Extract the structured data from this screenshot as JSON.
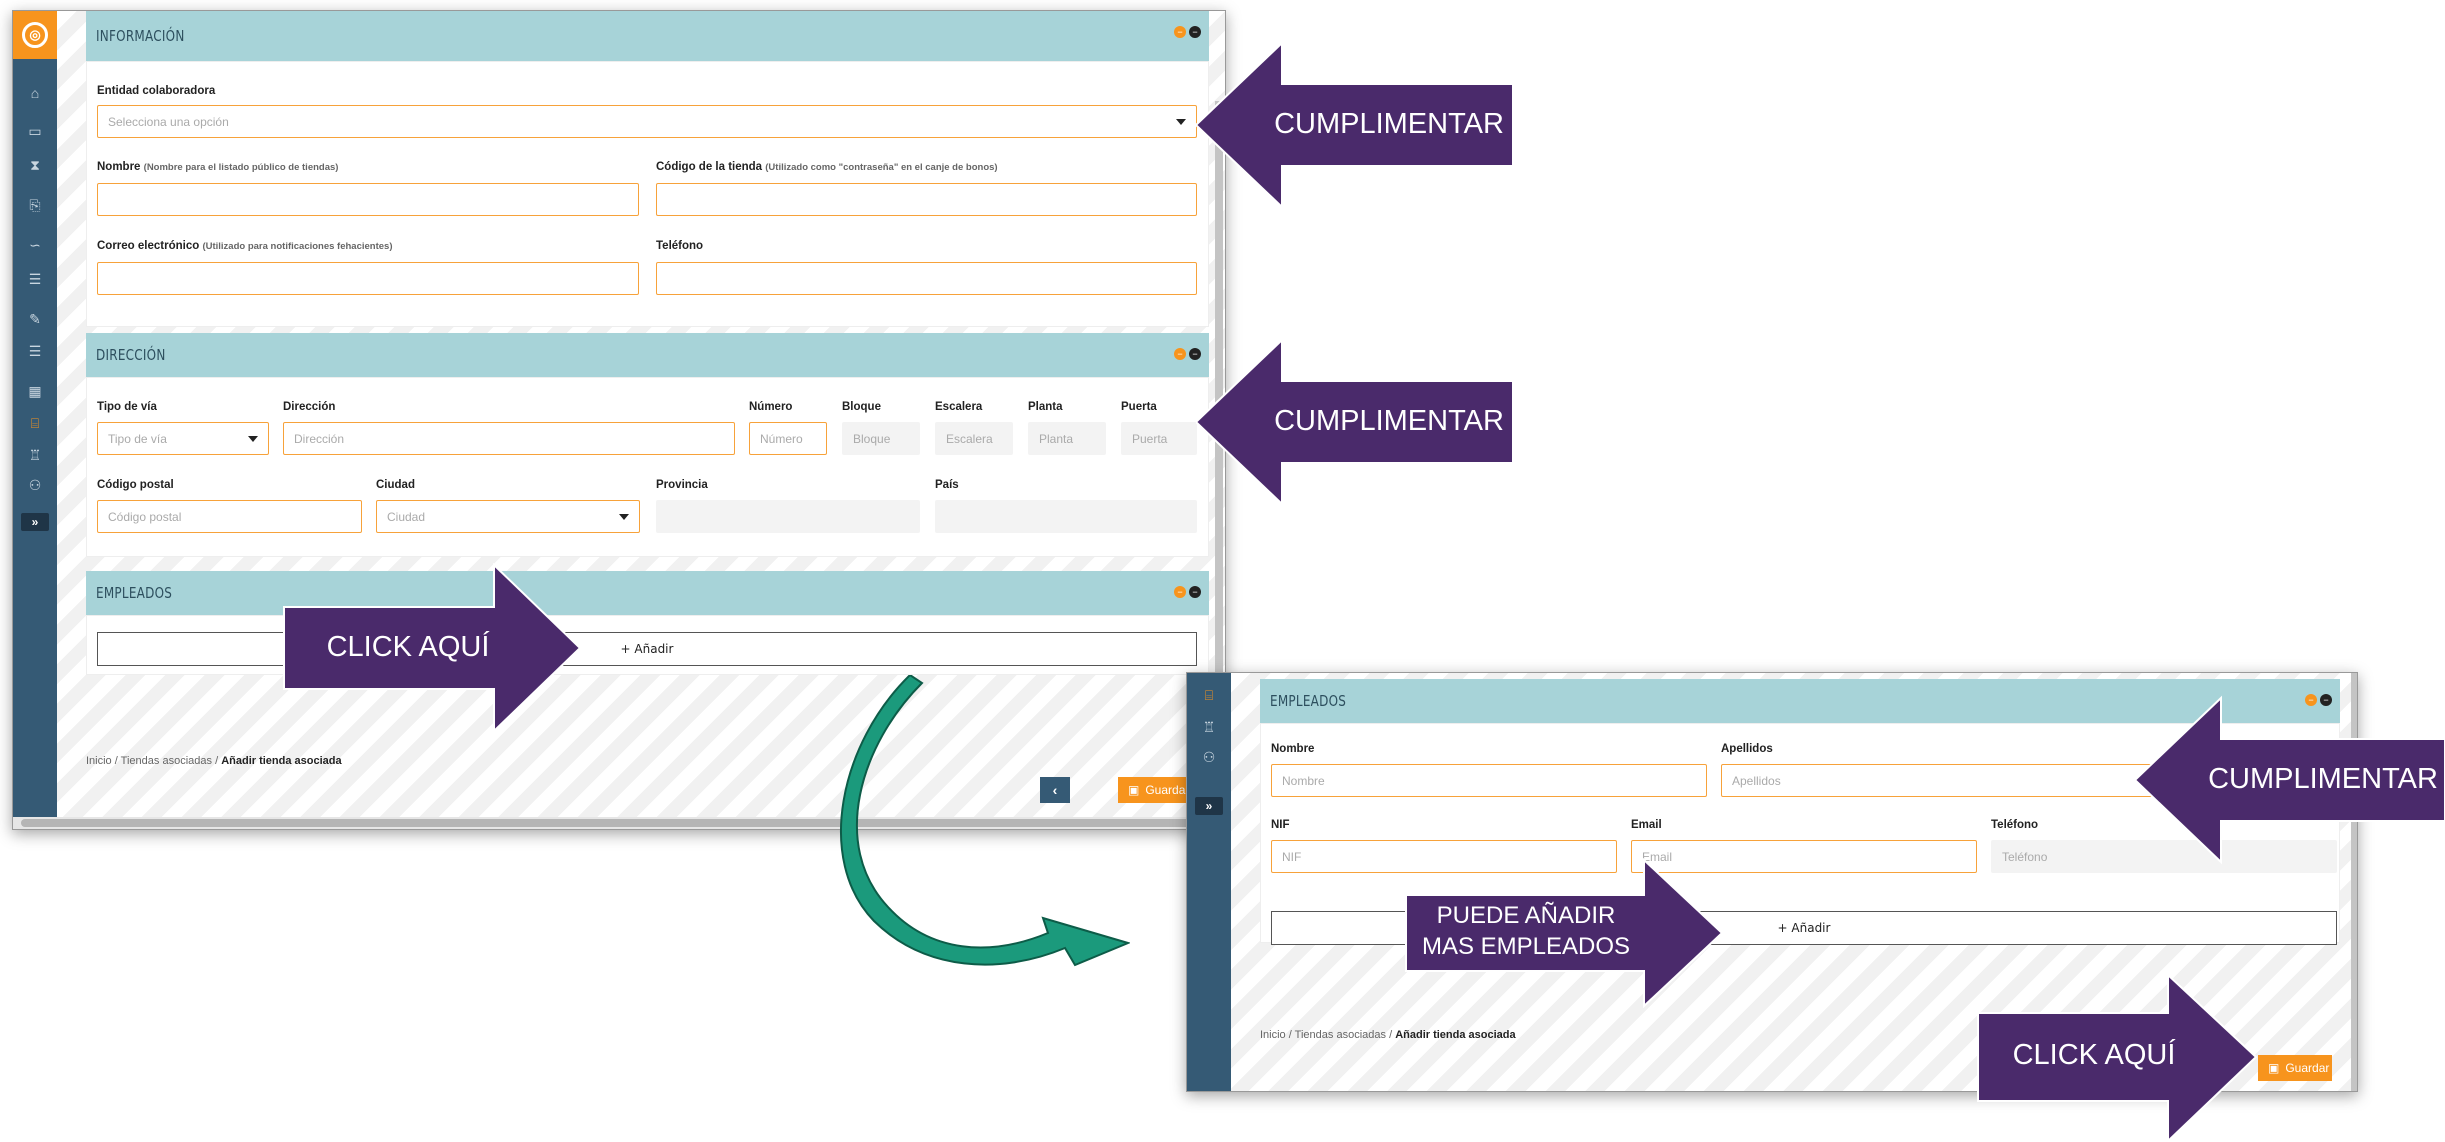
{
  "shot1": {
    "logo_glyph": "◎",
    "sidebar_icons": [
      "home-icon",
      "archive-icon",
      "hourglass-icon",
      "scroll-icon",
      "signature-icon",
      "list-icon",
      "edit-icon",
      "list-icon-2",
      "building-icon",
      "store-icon",
      "trophy-icon",
      "users-icon"
    ],
    "expand_glyph": "»",
    "informacion": {
      "title": "INFORMACIÓN",
      "entidad_label": "Entidad colaboradora",
      "entidad_placeholder": "Selecciona una opción",
      "nombre_label": "Nombre",
      "nombre_hint": "(Nombre para el listado público de tiendas)",
      "codigo_label": "Código de la tienda",
      "codigo_hint": "(Utilizado como \"contraseña\" en el canje de bonos)",
      "correo_label": "Correo electrónico",
      "correo_hint": "(Utilizado para notificaciones fehacientes)",
      "telefono_label": "Teléfono"
    },
    "direccion": {
      "title": "DIRECCIÓN",
      "tipo_via_label": "Tipo de vía",
      "tipo_via_placeholder": "Tipo de vía",
      "direccion_label": "Dirección",
      "direccion_placeholder": "Dirección",
      "numero_label": "Número",
      "numero_placeholder": "Número",
      "bloque_label": "Bloque",
      "bloque_placeholder": "Bloque",
      "escalera_label": "Escalera",
      "escalera_placeholder": "Escalera",
      "planta_label": "Planta",
      "planta_placeholder": "Planta",
      "puerta_label": "Puerta",
      "puerta_placeholder": "Puerta",
      "cp_label": "Código postal",
      "cp_placeholder": "Código postal",
      "ciudad_label": "Ciudad",
      "ciudad_placeholder": "Ciudad",
      "provincia_label": "Provincia",
      "pais_label": "País"
    },
    "empleados": {
      "title": "EMPLEADOS",
      "add_label": "+ Añadir"
    },
    "breadcrumb": {
      "inicio": "Inicio",
      "tiendas": "Tiendas asociadas",
      "current": "Añadir tienda asociada",
      "sep": "/"
    },
    "back_glyph": "‹",
    "save_label": "Guardar"
  },
  "shot2": {
    "sidebar_icons": [
      "store-icon",
      "trophy-icon",
      "users-icon"
    ],
    "expand_glyph": "»",
    "empleados": {
      "title": "EMPLEADOS",
      "nombre_label": "Nombre",
      "nombre_placeholder": "Nombre",
      "apellidos_label": "Apellidos",
      "apellidos_placeholder": "Apellidos",
      "nif_label": "NIF",
      "nif_placeholder": "NIF",
      "email_label": "Email",
      "email_placeholder": "Email",
      "telefono_label": "Teléfono",
      "telefono_placeholder": "Teléfono",
      "add_label": "+ Añadir"
    },
    "breadcrumb": {
      "inicio": "Inicio",
      "tiendas": "Tiendas asociadas",
      "current": "Añadir tienda asociada",
      "sep": "/"
    },
    "save_label": "Guardar"
  },
  "callouts": {
    "cumplimentar": "CUMPLIMENTAR",
    "click_aqui": "CLICK AQUÍ",
    "puede_line1": "PUEDE AÑADIR",
    "puede_line2": "MAS EMPLEADOS"
  },
  "colors": {
    "sidebar": "#355a75",
    "accent": "#f7941d",
    "panel_header": "#a7d3d8",
    "callout": "#4a2a6b",
    "curve_arrow": "#1b9a7c"
  }
}
